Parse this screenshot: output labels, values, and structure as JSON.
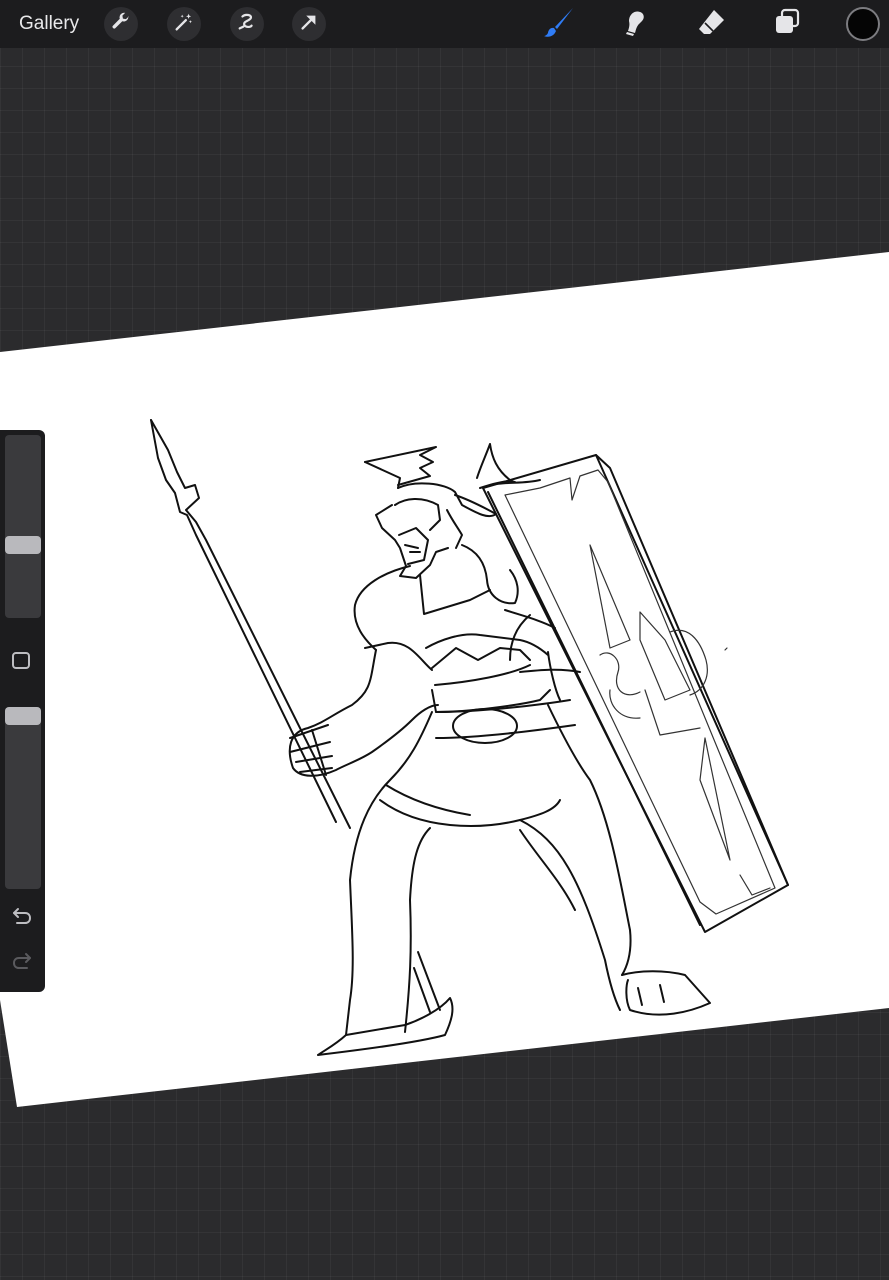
{
  "toolbar": {
    "gallery_label": "Gallery",
    "left_tools": [
      "wrench-icon",
      "magic-wand-icon",
      "selection-icon",
      "transform-arrow-icon"
    ],
    "right_tools": [
      "brush-icon",
      "smudge-icon",
      "eraser-icon",
      "layers-icon"
    ],
    "active_tool": "brush-icon",
    "active_color": "#050505",
    "accent_color": "#2f7cf6"
  },
  "sidebar": {
    "brush_size": 0.39,
    "brush_opacity": 0.0,
    "tools": [
      "modify-button",
      "undo-icon",
      "redo-icon"
    ]
  }
}
